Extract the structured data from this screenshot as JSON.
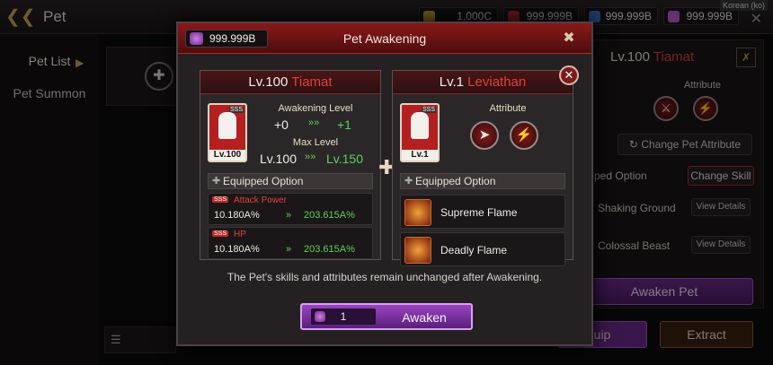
{
  "topbar": {
    "title": "Pet",
    "currencies": [
      "1,000C",
      "999.999B",
      "999.999B",
      "999.999B"
    ],
    "lang": "Korean (ko)"
  },
  "sidebar": {
    "items": [
      "Pet List",
      "Pet Summon"
    ]
  },
  "right": {
    "level": "Lv.100",
    "name": "Tiamat",
    "attribute_label": "Attribute",
    "change_attr": "Change Pet Attribute",
    "equipped_option": "ped Option",
    "change_skill": "Change Skill",
    "skills": [
      "Shaking Ground",
      "Colossal Beast"
    ],
    "view_details": "View Details",
    "awaken_pet": "Awaken Pet",
    "equip": "uip",
    "extract": "Extract"
  },
  "modal": {
    "title": "Pet Awakening",
    "balance": "999.999B",
    "note": "The Pet's skills and attributes remain unchanged after Awakening.",
    "count": "1",
    "awaken": "Awaken",
    "left": {
      "level": "Lv.100",
      "name": "Tiamat",
      "portrait_lv": "Lv.100",
      "awakening_label": "Awakening Level",
      "awk_from": "+0",
      "awk_to": "+1",
      "max_label": "Max Level",
      "max_from": "Lv.100",
      "max_to": "Lv.150",
      "equipped": "Equipped Option",
      "options": [
        {
          "name": "Attack Power",
          "from": "10.180A%",
          "to": "203.615A%"
        },
        {
          "name": "HP",
          "from": "10.180A%",
          "to": "203.615A%"
        }
      ]
    },
    "rightcard": {
      "level": "Lv.1",
      "name": "Leviathan",
      "portrait_lv": "Lv.1",
      "attribute_label": "Attribute",
      "equipped": "Equipped Option",
      "skills": [
        "Supreme Flame",
        "Deadly Flame"
      ]
    }
  }
}
